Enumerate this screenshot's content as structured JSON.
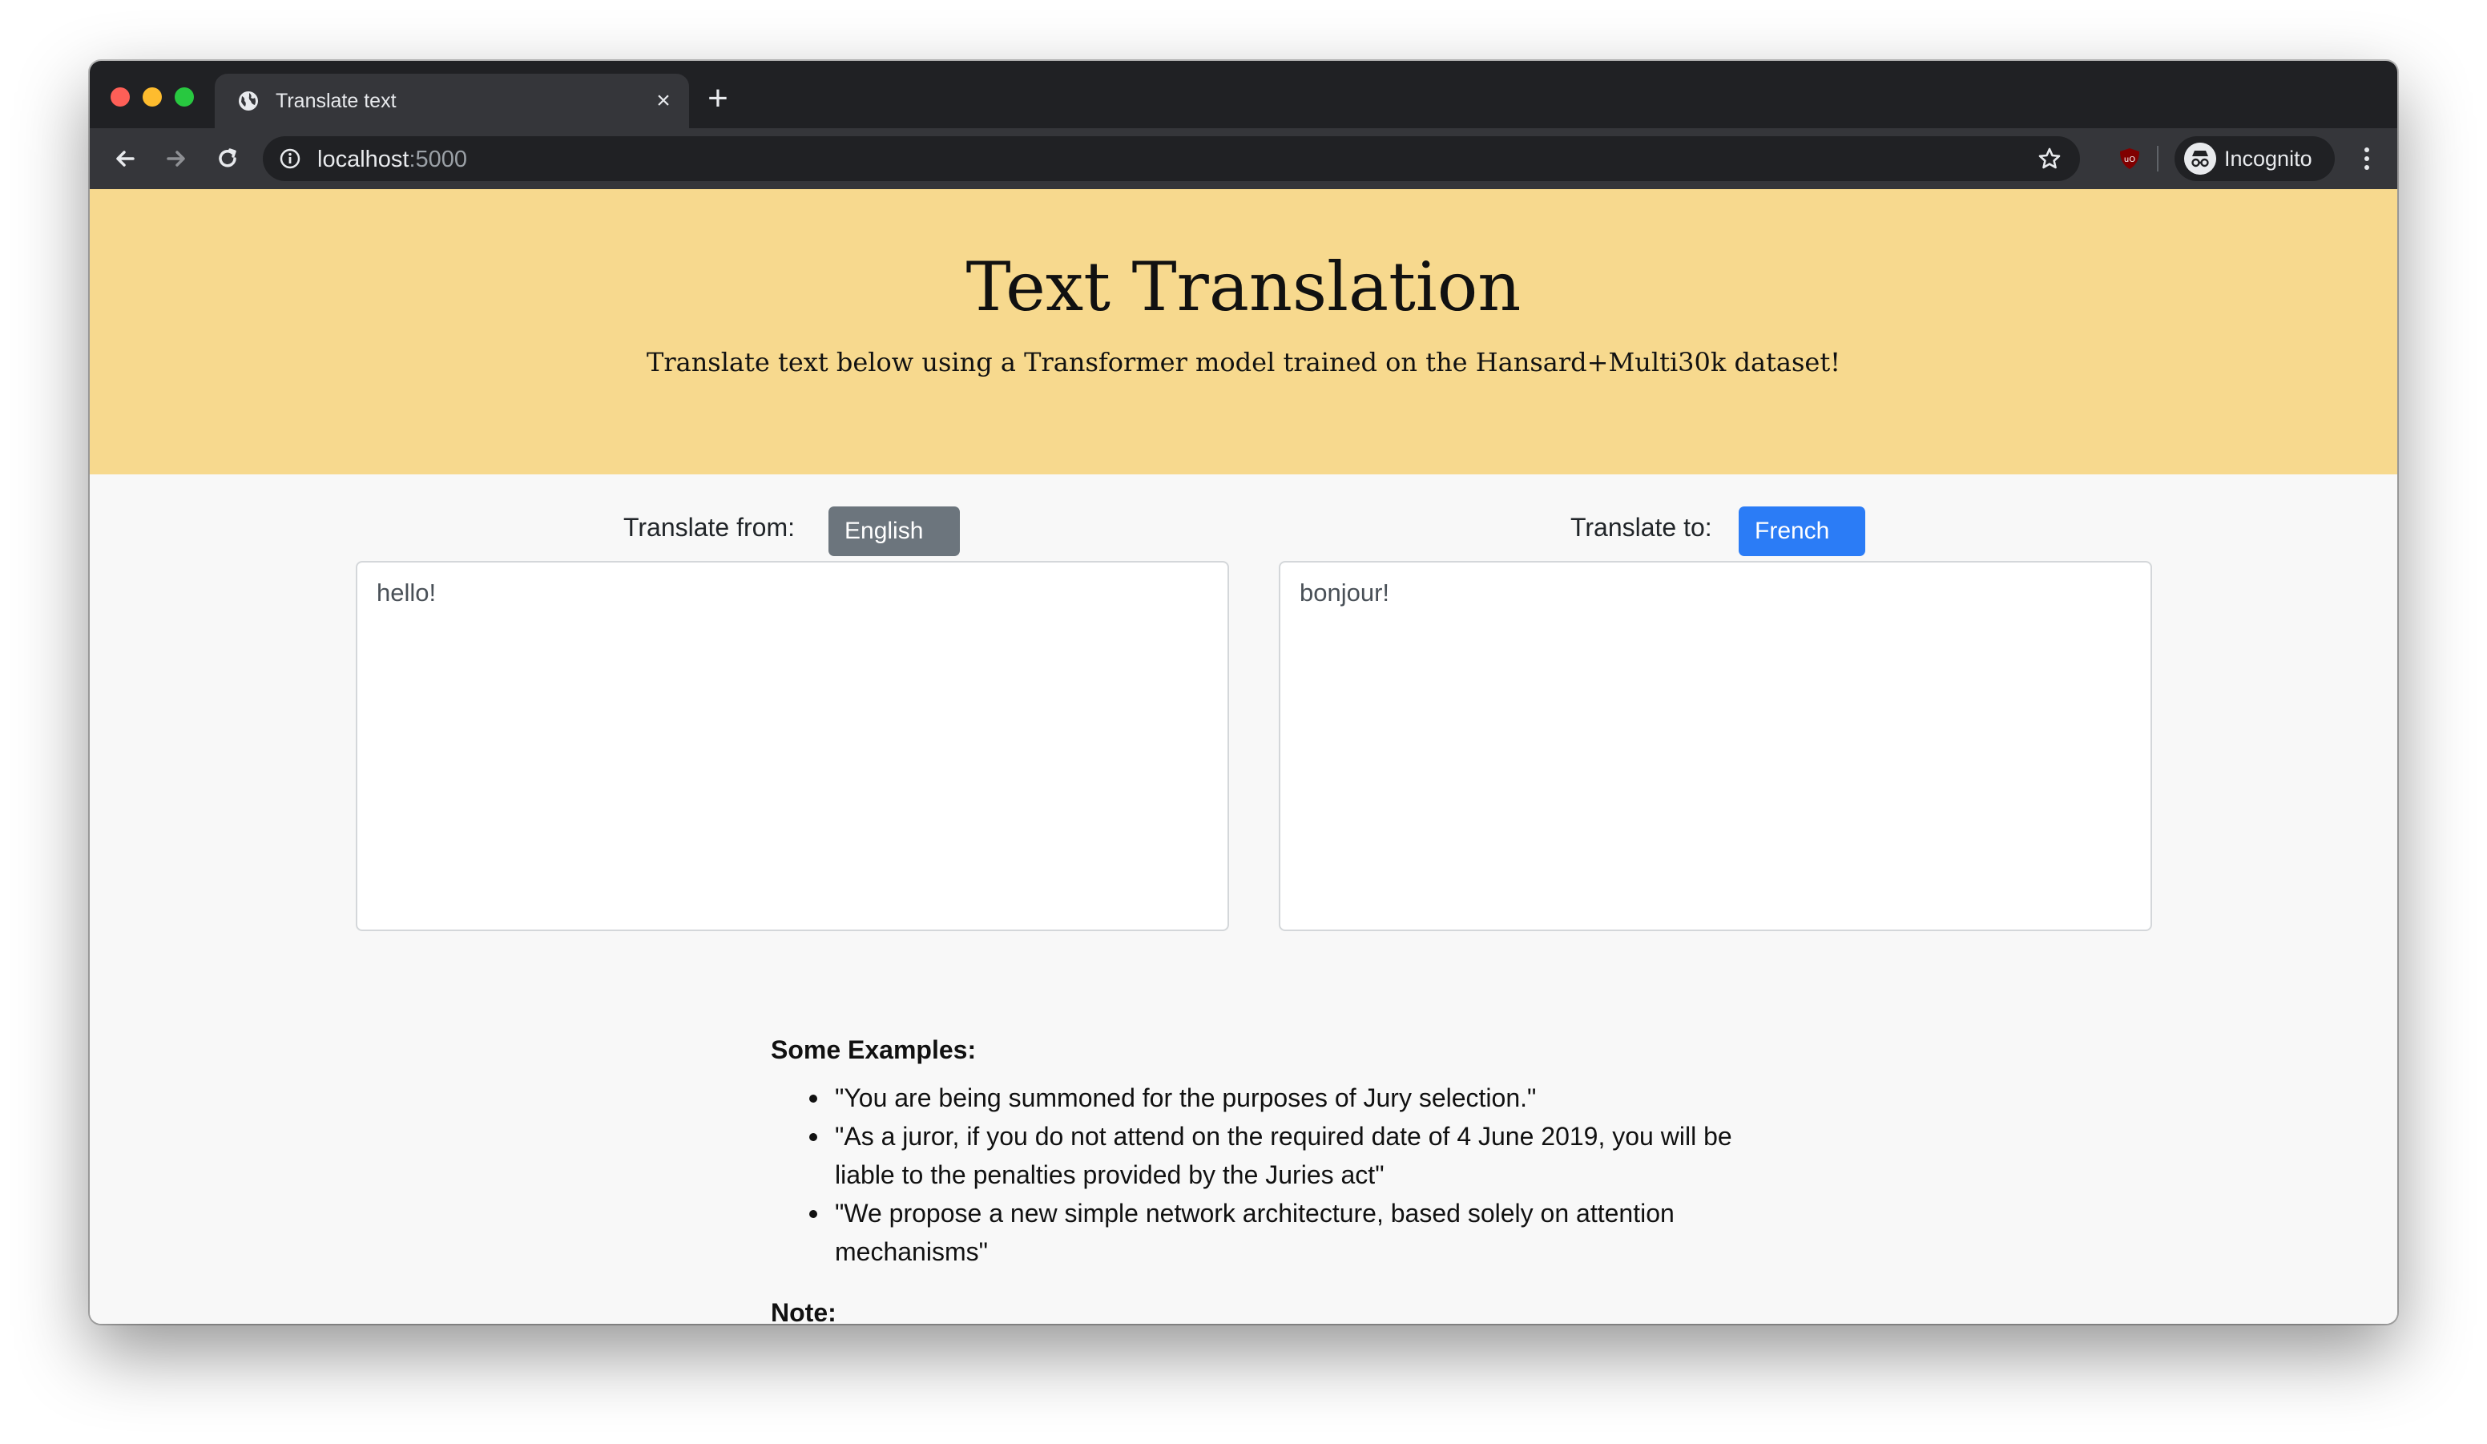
{
  "browser": {
    "tab_title": "Translate text",
    "url_host": "localhost",
    "url_port": ":5000",
    "profile_label": "Incognito"
  },
  "hero": {
    "title": "Text Translation",
    "subtitle": "Translate text below using a Transformer model trained on the Hansard+Multi30k dataset!"
  },
  "translator": {
    "from_label": "Translate from:",
    "from_language": "English",
    "to_label": "Translate to:",
    "to_language": "French",
    "input_text": "hello!",
    "output_text": "bonjour!"
  },
  "examples": {
    "heading": "Some Examples:",
    "items": [
      "\"You are being summoned for the purposes of Jury selection.\"",
      "\"As a juror, if you do not attend on the required date of 4 June 2019, you will be liable to the penalties provided by the Juries act\"",
      "\"We propose a new simple network architecture, based solely on attention mechanisms\""
    ]
  },
  "note": {
    "heading": "Note:"
  },
  "colors": {
    "hero_bg": "#f7d98e",
    "from_button": "#6c757d",
    "to_button": "#2b7cf6"
  },
  "icons": [
    "globe-icon",
    "close-icon",
    "plus-icon",
    "back-arrow-icon",
    "forward-arrow-icon",
    "reload-icon",
    "info-icon",
    "star-icon",
    "ublock-icon",
    "incognito-icon",
    "kebab-menu-icon",
    "chevron-down-icon"
  ]
}
